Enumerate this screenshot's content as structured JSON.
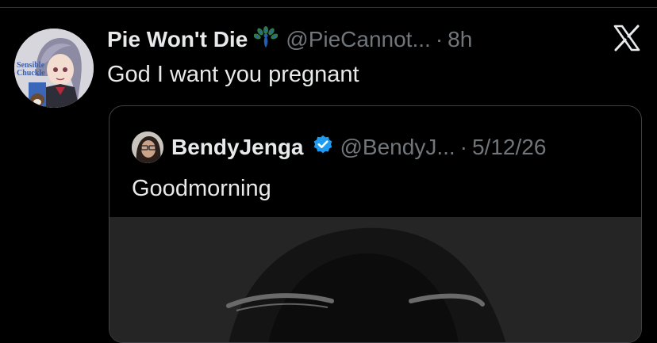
{
  "tweet": {
    "display_name": "Pie Won't Die",
    "emoji_icon": "peacock-icon",
    "handle": "@PieCannot...",
    "separator": "·",
    "time": "8h",
    "text": "God I want you pregnant",
    "avatar_caption": "Sensible Chuckle"
  },
  "quote": {
    "display_name": "BendyJenga",
    "badge_icon": "verified-icon",
    "handle": "@BendyJ...",
    "separator": "·",
    "date": "5/12/26",
    "text": "Goodmorning"
  },
  "colors": {
    "background": "#000000",
    "text_primary": "#e7e9ea",
    "text_secondary": "#71767b",
    "verified_blue": "#1d9bf0",
    "border": "#3e4144"
  }
}
